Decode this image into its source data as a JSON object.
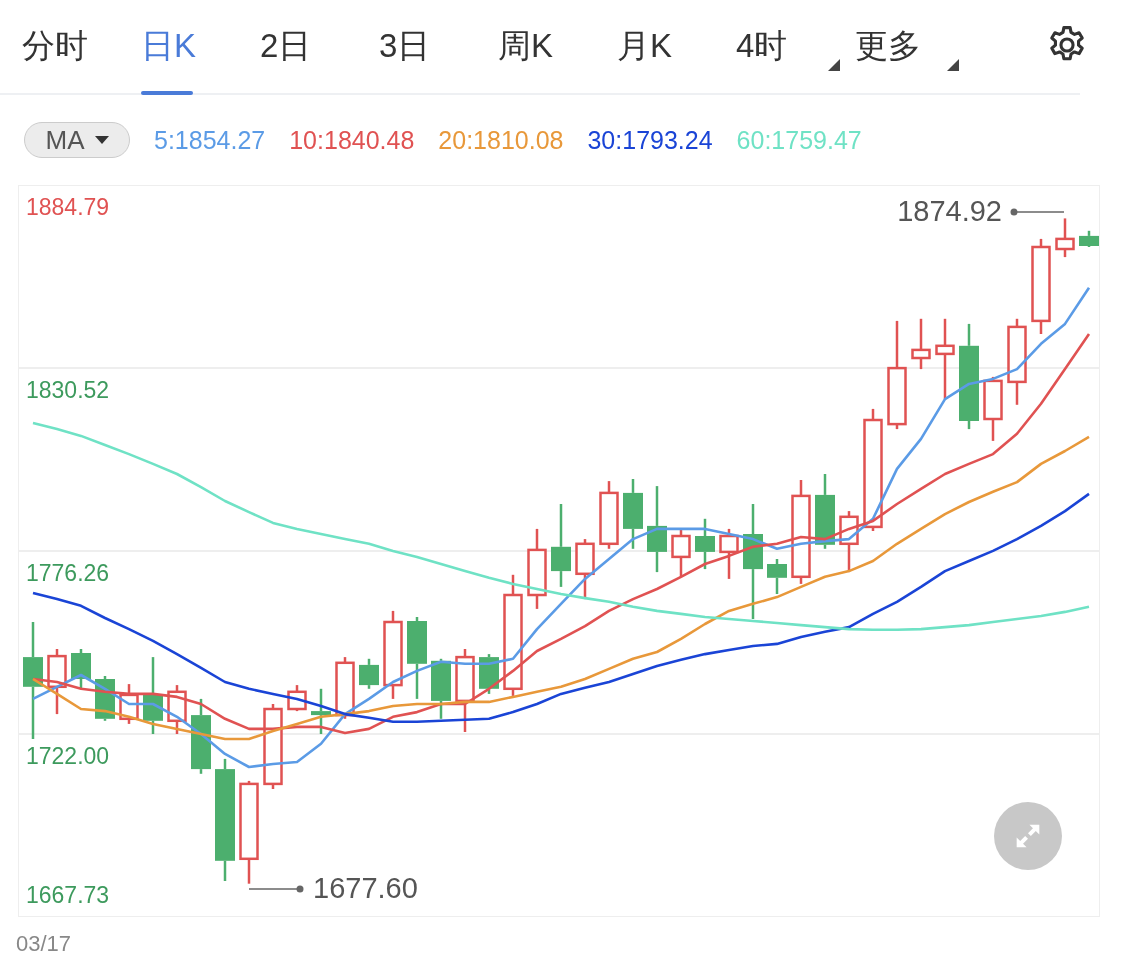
{
  "tabs": [
    {
      "label": "分时",
      "selected": false,
      "dropdown": false
    },
    {
      "label": "日K",
      "selected": true,
      "dropdown": false
    },
    {
      "label": "2日",
      "selected": false,
      "dropdown": false
    },
    {
      "label": "3日",
      "selected": false,
      "dropdown": false
    },
    {
      "label": "周K",
      "selected": false,
      "dropdown": false
    },
    {
      "label": "月K",
      "selected": false,
      "dropdown": false
    },
    {
      "label": "4时",
      "selected": false,
      "dropdown": true
    },
    {
      "label": "更多",
      "selected": false,
      "dropdown": true
    }
  ],
  "indicator": {
    "label": "MA",
    "values": [
      {
        "text": "5:1854.27",
        "color": "#5b9be6"
      },
      {
        "text": "10:1840.48",
        "color": "#e05252"
      },
      {
        "text": "20:1810.08",
        "color": "#e8983a"
      },
      {
        "text": "30:1793.24",
        "color": "#1a44d6"
      },
      {
        "text": "60:1759.47",
        "color": "#6fe2c5"
      }
    ]
  },
  "chart": {
    "bottom_label": "1667.73",
    "high_marker": "1874.92",
    "low_marker": "1677.60",
    "chart_data": {
      "type": "line",
      "grid": true,
      "yticks": [
        {
          "value": 1884.79,
          "label": "1884.79"
        },
        {
          "value": 1830.52,
          "label": "1830.52"
        },
        {
          "value": 1776.26,
          "label": "1776.26"
        },
        {
          "value": 1722.0,
          "label": "1722.00"
        }
      ],
      "ylim": [
        1667.73,
        1884.79
      ],
      "series": [
        {
          "color": "#5b9be6",
          "values": [
            1732.4,
            1736.0,
            1739.5,
            1735.4,
            1730.9,
            1730.9,
            1727.1,
            1722.0,
            1716.1,
            1712.2,
            1713.1,
            1713.7,
            1719.1,
            1727.9,
            1732.4,
            1737.4,
            1740.7,
            1743.4,
            1742.8,
            1742.8,
            1744.3,
            1753.1,
            1760.6,
            1768.0,
            1773.9,
            1779.8,
            1782.8,
            1782.8,
            1782.8,
            1781.3,
            1779.8,
            1776.9,
            1778.4,
            1779.2,
            1779.8,
            1785.8,
            1800.6,
            1809.5,
            1821.3,
            1825.8,
            1827.3,
            1830.2,
            1837.7,
            1843.6,
            1854.3
          ]
        },
        {
          "color": "#e05252",
          "values": [
            1738.3,
            1737.4,
            1735.4,
            1734.5,
            1733.9,
            1733.9,
            1733.0,
            1730.9,
            1726.5,
            1723.5,
            1723.5,
            1724.1,
            1724.1,
            1722.3,
            1723.5,
            1727.1,
            1728.5,
            1730.9,
            1730.9,
            1735.4,
            1740.7,
            1746.6,
            1750.2,
            1754.0,
            1758.5,
            1762.0,
            1765.0,
            1768.6,
            1772.4,
            1774.8,
            1777.5,
            1778.4,
            1780.4,
            1779.8,
            1782.8,
            1785.2,
            1790.2,
            1794.7,
            1799.1,
            1802.1,
            1805.0,
            1811.0,
            1819.9,
            1830.2,
            1840.6
          ]
        },
        {
          "color": "#e8983a",
          "values": [
            1738.3,
            1733.9,
            1729.4,
            1728.8,
            1727.1,
            1725.0,
            1723.5,
            1722.0,
            1720.5,
            1720.5,
            1722.9,
            1725.0,
            1727.1,
            1727.9,
            1728.8,
            1730.3,
            1730.9,
            1730.9,
            1731.5,
            1731.5,
            1733.0,
            1734.5,
            1736.0,
            1738.3,
            1741.3,
            1744.3,
            1746.3,
            1750.2,
            1754.6,
            1758.5,
            1760.6,
            1762.6,
            1765.6,
            1768.6,
            1770.3,
            1773.3,
            1778.4,
            1782.8,
            1787.2,
            1790.8,
            1793.8,
            1796.7,
            1802.1,
            1805.9,
            1810.1
          ]
        },
        {
          "color": "#1a44d6",
          "values": [
            1763.8,
            1762.0,
            1760.0,
            1756.4,
            1753.1,
            1749.6,
            1745.7,
            1741.6,
            1737.4,
            1735.4,
            1733.9,
            1732.4,
            1730.3,
            1727.9,
            1726.8,
            1725.6,
            1725.6,
            1725.9,
            1726.2,
            1726.5,
            1728.5,
            1730.9,
            1733.9,
            1735.7,
            1737.4,
            1739.8,
            1742.2,
            1744.0,
            1745.7,
            1746.9,
            1748.1,
            1748.7,
            1750.8,
            1752.3,
            1753.7,
            1757.6,
            1761.2,
            1765.6,
            1770.3,
            1773.3,
            1776.3,
            1779.8,
            1783.7,
            1788.1,
            1793.2
          ]
        },
        {
          "color": "#6fe2c5",
          "values": [
            1814.2,
            1812.4,
            1810.4,
            1807.7,
            1805.0,
            1802.1,
            1799.1,
            1795.2,
            1791.1,
            1787.8,
            1784.6,
            1782.8,
            1781.3,
            1779.8,
            1778.4,
            1776.3,
            1774.5,
            1772.4,
            1770.3,
            1768.3,
            1766.5,
            1765.0,
            1763.5,
            1762.3,
            1761.2,
            1759.7,
            1758.5,
            1757.6,
            1756.7,
            1756.1,
            1755.5,
            1754.9,
            1754.3,
            1753.7,
            1753.1,
            1752.9,
            1752.9,
            1753.1,
            1753.7,
            1754.3,
            1755.2,
            1756.1,
            1757.0,
            1758.2,
            1759.7
          ]
        }
      ]
    }
  },
  "x_label": "03/17"
}
